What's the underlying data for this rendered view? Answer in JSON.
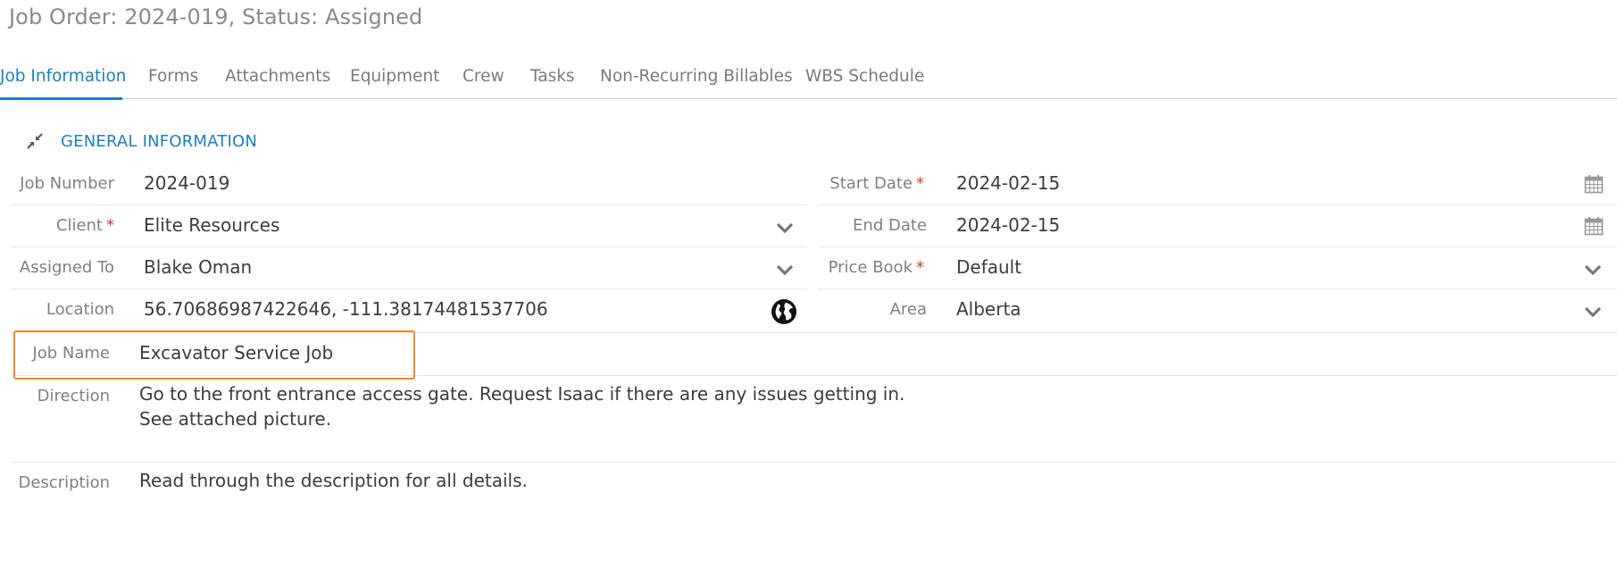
{
  "header": {
    "title": "Job Order: 2024-019, Status: Assigned"
  },
  "tabs": [
    {
      "label": "Job Information",
      "active": true
    },
    {
      "label": "Forms"
    },
    {
      "label": "Attachments"
    },
    {
      "label": "Equipment"
    },
    {
      "label": "Crew"
    },
    {
      "label": "Tasks"
    },
    {
      "label": "Non-Recurring Billables"
    },
    {
      "label": "WBS Schedule"
    }
  ],
  "section": {
    "title": "GENERAL INFORMATION",
    "icon": "collapse-icon"
  },
  "fields": {
    "job_number": {
      "label": "Job Number",
      "value": "2024-019"
    },
    "client": {
      "label": "Client",
      "value": "Elite Resources",
      "required": "*"
    },
    "assigned_to": {
      "label": "Assigned To",
      "value": "Blake Oman"
    },
    "location": {
      "label": "Location",
      "value": "56.70686987422646, -111.38174481537706",
      "icon": "globe-icon"
    },
    "start_date": {
      "label": "Start Date",
      "value": "2024-02-15",
      "required": "*",
      "icon": "calendar-icon"
    },
    "end_date": {
      "label": "End Date",
      "value": "2024-02-15",
      "icon": "calendar-icon"
    },
    "price_book": {
      "label": "Price Book",
      "value": "Default",
      "required": "*"
    },
    "area": {
      "label": "Area",
      "value": "Alberta"
    },
    "job_name": {
      "label": "Job Name",
      "value": "Excavator Service Job"
    },
    "direction": {
      "label": "Direction",
      "line1": "Go to the front entrance access gate.  Request Isaac if there are any issues getting in.",
      "line2": "See attached picture."
    },
    "description": {
      "label": "Description",
      "value": "Read through the description for all details."
    }
  },
  "colors": {
    "accent": "#1b7fc2",
    "required": "#d9392b",
    "highlight": "#f08a24",
    "label": "#7f7f7f",
    "value": "#3c3c3c"
  }
}
